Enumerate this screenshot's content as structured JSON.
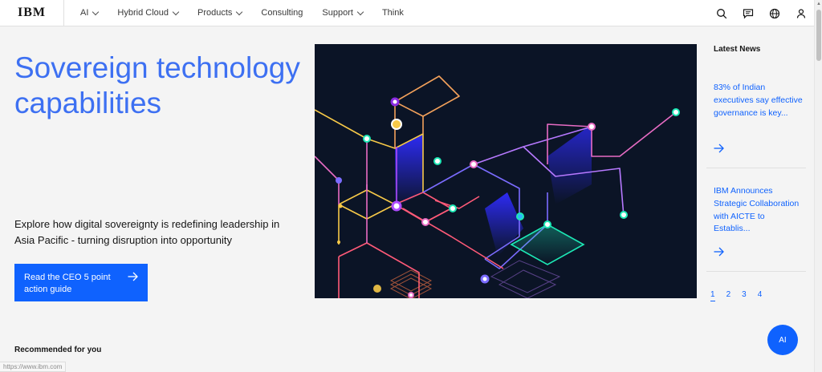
{
  "nav": {
    "logo": "IBM",
    "items": [
      {
        "label": "AI",
        "dropdown": true
      },
      {
        "label": "Hybrid Cloud",
        "dropdown": true
      },
      {
        "label": "Products",
        "dropdown": true
      },
      {
        "label": "Consulting",
        "dropdown": false
      },
      {
        "label": "Support",
        "dropdown": true
      },
      {
        "label": "Think",
        "dropdown": false
      }
    ],
    "icons": [
      "search-icon",
      "chat-icon",
      "globe-icon",
      "user-icon"
    ]
  },
  "hero": {
    "title": "Sovereign technology capabilities",
    "description": "Explore how digital sovereignty is redefining leadership in Asia Pacific - turning disruption into opportunity",
    "cta_label": "Read the CEO 5 point action guide"
  },
  "news": {
    "heading": "Latest News",
    "items": [
      {
        "title": "83% of Indian executives say effective governance is key..."
      },
      {
        "title": "IBM Announces Strategic Collaboration with AICTE to Establis..."
      }
    ],
    "pages": [
      "1",
      "2",
      "3",
      "4"
    ],
    "active_page": "1"
  },
  "recommended": {
    "heading": "Recommended for you"
  },
  "ai_button": {
    "label": "AI"
  },
  "status_url": "https://www.ibm.com",
  "colors": {
    "accent": "#0f62fe",
    "title": "#3d70f2",
    "hero_bg": "#0b1426"
  }
}
